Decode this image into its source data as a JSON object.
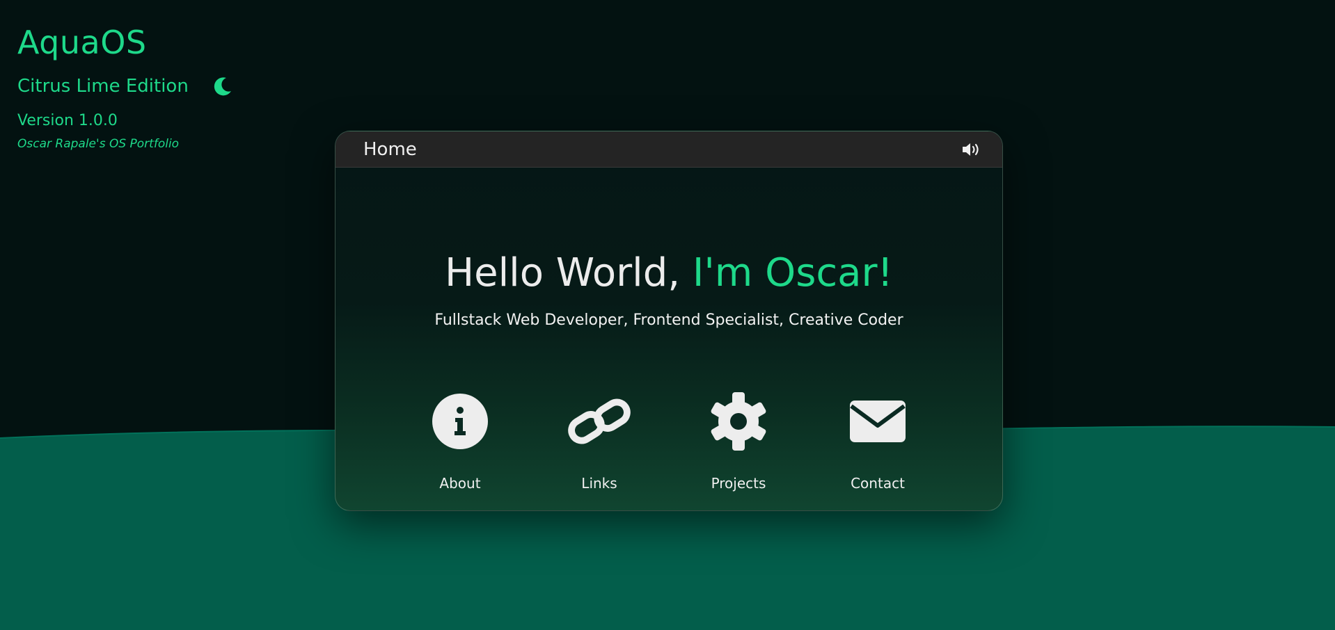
{
  "brand": {
    "title": "AquaOS",
    "edition": "Citrus Lime Edition",
    "version": "Version 1.0.0",
    "tagline": "Oscar Rapale's OS Portfolio",
    "theme_toggle_icon": "moon-icon"
  },
  "window": {
    "title": "Home",
    "sound_icon": "speaker-volume-icon"
  },
  "hero": {
    "greeting": "Hello World, ",
    "name": "I'm Oscar!",
    "subtitle": "Fullstack Web Developer, Frontend Specialist, Creative Coder"
  },
  "apps": [
    {
      "label": "About",
      "icon": "info-icon"
    },
    {
      "label": "Links",
      "icon": "link-icon"
    },
    {
      "label": "Projects",
      "icon": "gear-icon"
    },
    {
      "label": "Contact",
      "icon": "envelope-icon"
    }
  ],
  "colors": {
    "accent": "#1ed98a",
    "background": "#031211",
    "wave": "#035e4b",
    "titlebar": "#242424",
    "icon": "#ededed"
  }
}
